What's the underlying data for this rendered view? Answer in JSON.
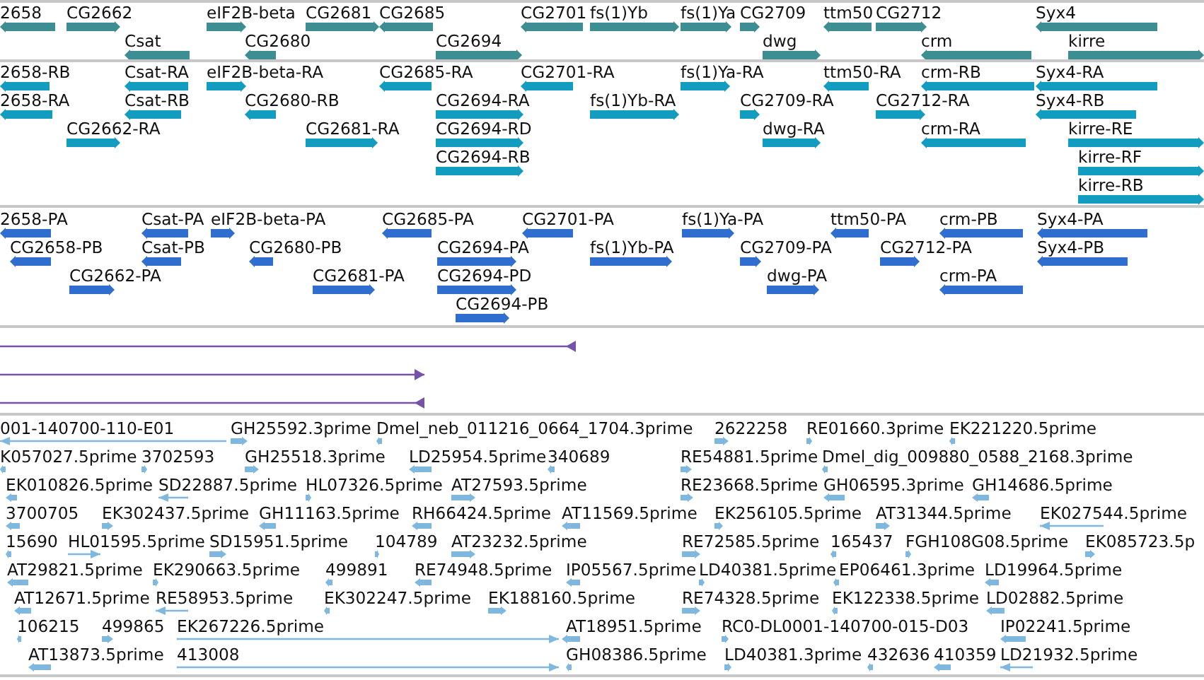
{
  "tracks": [
    {
      "kind": "bar",
      "color": "#3d8e93",
      "lanes": [
        {
          "features": [
            {
              "label": "2658",
              "reverse": true
            },
            {
              "label": "CG2662",
              "reverse": false
            },
            {
              "label": "eIF2B-beta",
              "reverse": false
            },
            {
              "label": "CG2681",
              "reverse": false
            },
            {
              "label": "CG2685",
              "reverse": true
            },
            {
              "label": "CG2701",
              "reverse": true
            },
            {
              "label": "fs(1)Yb",
              "reverse": false
            },
            {
              "label": "fs(1)Ya",
              "reverse": false
            },
            {
              "label": "CG2709",
              "reverse": false
            },
            {
              "label": "ttm50",
              "reverse": true
            },
            {
              "label": "CG2712",
              "reverse": false
            },
            {
              "label": "Syx4",
              "reverse": true
            }
          ]
        },
        {
          "features": [
            {
              "label": "Csat",
              "reverse": true
            },
            {
              "label": "CG2680",
              "reverse": true
            },
            {
              "label": "CG2694",
              "reverse": false
            },
            {
              "label": "dwg",
              "reverse": false
            },
            {
              "label": "crm",
              "reverse": true
            },
            {
              "label": "kirre",
              "reverse": false
            }
          ]
        }
      ]
    },
    {
      "kind": "bar",
      "color": "#119cc0",
      "lanes": [
        {
          "features": [
            {
              "label": "2658-RB",
              "reverse": true
            },
            {
              "label": "Csat-RA",
              "reverse": true
            },
            {
              "label": "eIF2B-beta-RA",
              "reverse": false
            },
            {
              "label": "CG2685-RA",
              "reverse": true
            },
            {
              "label": "CG2701-RA",
              "reverse": true
            },
            {
              "label": "fs(1)Ya-RA",
              "reverse": false
            },
            {
              "label": "ttm50-RA",
              "reverse": true
            },
            {
              "label": "crm-RB",
              "reverse": true
            },
            {
              "label": "Syx4-RA",
              "reverse": true
            }
          ]
        },
        {
          "features": [
            {
              "label": "2658-RA",
              "reverse": true
            },
            {
              "label": "Csat-RB",
              "reverse": true
            },
            {
              "label": "CG2680-RB",
              "reverse": true
            },
            {
              "label": "CG2694-RA",
              "reverse": false
            },
            {
              "label": "fs(1)Yb-RA",
              "reverse": false
            },
            {
              "label": "CG2709-RA",
              "reverse": false
            },
            {
              "label": "CG2712-RA",
              "reverse": false
            },
            {
              "label": "Syx4-RB",
              "reverse": true
            }
          ]
        },
        {
          "features": [
            {
              "label": "CG2662-RA",
              "reverse": false
            },
            {
              "label": "CG2681-RA",
              "reverse": false
            },
            {
              "label": "CG2694-RD",
              "reverse": false
            },
            {
              "label": "dwg-RA",
              "reverse": false
            },
            {
              "label": "crm-RA",
              "reverse": true
            },
            {
              "label": "kirre-RE",
              "reverse": false
            }
          ]
        },
        {
          "features": [
            {
              "label": "CG2694-RB",
              "reverse": false
            },
            {
              "label": "kirre-RF",
              "reverse": false
            }
          ]
        },
        {
          "features": [
            {
              "label": "kirre-RB",
              "reverse": false
            }
          ]
        }
      ]
    },
    {
      "kind": "bar",
      "color": "#2f6ece",
      "lanes": [
        {
          "features": [
            {
              "label": "2658-PA",
              "reverse": true
            },
            {
              "label": "Csat-PA",
              "reverse": true
            },
            {
              "label": "eIF2B-beta-PA",
              "reverse": false
            },
            {
              "label": "CG2685-PA",
              "reverse": true
            },
            {
              "label": "CG2701-PA",
              "reverse": true
            },
            {
              "label": "fs(1)Ya-PA",
              "reverse": false
            },
            {
              "label": "ttm50-PA",
              "reverse": true
            },
            {
              "label": "crm-PB",
              "reverse": true
            },
            {
              "label": "Syx4-PA",
              "reverse": true
            }
          ]
        },
        {
          "features": [
            {
              "label": "CG2658-PB",
              "reverse": true
            },
            {
              "label": "Csat-PB",
              "reverse": true
            },
            {
              "label": "CG2680-PB",
              "reverse": true
            },
            {
              "label": "CG2694-PA",
              "reverse": false
            },
            {
              "label": "fs(1)Yb-PA",
              "reverse": false
            },
            {
              "label": "CG2709-PA",
              "reverse": false
            },
            {
              "label": "CG2712-PA",
              "reverse": false
            },
            {
              "label": "Syx4-PB",
              "reverse": true
            }
          ]
        },
        {
          "features": [
            {
              "label": "CG2662-PA",
              "reverse": false
            },
            {
              "label": "CG2681-PA",
              "reverse": false
            },
            {
              "label": "CG2694-PD",
              "reverse": false
            },
            {
              "label": "dwg-PA",
              "reverse": false
            },
            {
              "label": "crm-PA",
              "reverse": true
            }
          ]
        },
        {
          "features": [
            {
              "label": "CG2694-PB",
              "reverse": false
            }
          ]
        }
      ]
    },
    {
      "kind": "line",
      "color": "#7652a8",
      "lanes": [
        {
          "features": [
            {
              "reverse": true
            }
          ]
        },
        {
          "features": [
            {
              "reverse": false
            }
          ]
        },
        {
          "features": [
            {
              "reverse": true
            }
          ]
        }
      ]
    },
    {
      "kind": "small",
      "color": "#80b7df",
      "lanes": [
        {
          "features": [
            {
              "label": "001-140700-110-E01",
              "reverse": true
            },
            {
              "label": "GH25592.3prime",
              "reverse": false
            },
            {
              "label": "Dmel_neb_011216_0664_1704.3prime",
              "reverse": true
            },
            {
              "label": "2622258",
              "reverse": false
            },
            {
              "label": "RE01660.3prime",
              "reverse": false
            },
            {
              "label": "EK221220.5prime",
              "reverse": true
            }
          ]
        },
        {
          "features": [
            {
              "label": "K057027.5prime",
              "reverse": true
            },
            {
              "label": "3702593",
              "reverse": false
            },
            {
              "label": "GH25518.3prime",
              "reverse": false
            },
            {
              "label": "LD25954.5prime",
              "reverse": true
            },
            {
              "label": "340689",
              "reverse": true
            },
            {
              "label": "RE54881.5prime",
              "reverse": false
            },
            {
              "label": "Dmel_dig_009880_0588_2168.3prime",
              "reverse": true
            }
          ]
        },
        {
          "features": [
            {
              "label": "EK010826.5prime",
              "reverse": true
            },
            {
              "label": "SD22887.5prime",
              "reverse": true
            },
            {
              "label": "HL07326.5prime",
              "reverse": false
            },
            {
              "label": "AT27593.5prime",
              "reverse": false
            },
            {
              "label": "RE23668.5prime",
              "reverse": false
            },
            {
              "label": "GH06595.3prime",
              "reverse": true
            },
            {
              "label": "GH14686.5prime",
              "reverse": true
            }
          ]
        },
        {
          "features": [
            {
              "label": "3700705",
              "reverse": true
            },
            {
              "label": "EK302437.5prime",
              "reverse": false
            },
            {
              "label": "GH11163.5prime",
              "reverse": true
            },
            {
              "label": "RH66424.5prime",
              "reverse": true
            },
            {
              "label": "AT11569.5prime",
              "reverse": true
            },
            {
              "label": "EK256105.5prime",
              "reverse": false
            },
            {
              "label": "AT31344.5prime",
              "reverse": false
            },
            {
              "label": "EK027544.5prime",
              "reverse": true
            }
          ]
        },
        {
          "features": [
            {
              "label": "15690",
              "reverse": true
            },
            {
              "label": "HL01595.5prime",
              "reverse": false
            },
            {
              "label": "SD15951.5prime",
              "reverse": false
            },
            {
              "label": "104789",
              "reverse": false
            },
            {
              "label": "AT23232.5prime",
              "reverse": false
            },
            {
              "label": "RE72585.5prime",
              "reverse": false
            },
            {
              "label": "165437",
              "reverse": true
            },
            {
              "label": "FGH108G08.5prime",
              "reverse": false
            },
            {
              "label": "EK085723.5p",
              "reverse": false
            }
          ]
        },
        {
          "features": [
            {
              "label": "AT29821.5prime",
              "reverse": true
            },
            {
              "label": "EK290663.5prime",
              "reverse": false
            },
            {
              "label": "499891",
              "reverse": true
            },
            {
              "label": "RE74948.5prime",
              "reverse": true
            },
            {
              "label": "IP05567.5prime",
              "reverse": true
            },
            {
              "label": "LD40381.5prime",
              "reverse": false
            },
            {
              "label": "EP06461.3prime",
              "reverse": true
            },
            {
              "label": "LD19964.5prime",
              "reverse": true
            }
          ]
        },
        {
          "features": [
            {
              "label": "AT12671.5prime",
              "reverse": true
            },
            {
              "label": "RE58953.5prime",
              "reverse": true
            },
            {
              "label": "EK302247.5prime",
              "reverse": true
            },
            {
              "label": "EK188160.5prime",
              "reverse": false
            },
            {
              "label": "RE74328.5prime",
              "reverse": false
            },
            {
              "label": "EK122338.5prime",
              "reverse": true
            },
            {
              "label": "LD02882.5prime",
              "reverse": true
            }
          ]
        },
        {
          "features": [
            {
              "label": "106215",
              "reverse": true
            },
            {
              "label": "499865",
              "reverse": false
            },
            {
              "label": "EK267226.5prime",
              "reverse": false
            },
            {
              "label": "AT18951.5prime",
              "reverse": true
            },
            {
              "label": "RC0-DL0001-140700-015-D03",
              "reverse": false
            },
            {
              "label": "IP02241.5prime",
              "reverse": true
            }
          ]
        },
        {
          "features": [
            {
              "label": "AT13873.5prime",
              "reverse": true
            },
            {
              "label": "413008",
              "reverse": false
            },
            {
              "label": "GH08386.5prime",
              "reverse": true
            },
            {
              "label": "LD40381.3prime",
              "reverse": false
            },
            {
              "label": "432636",
              "reverse": true
            },
            {
              "label": "410359",
              "reverse": true
            },
            {
              "label": "LD21932.5prime",
              "reverse": true
            }
          ]
        }
      ]
    }
  ]
}
